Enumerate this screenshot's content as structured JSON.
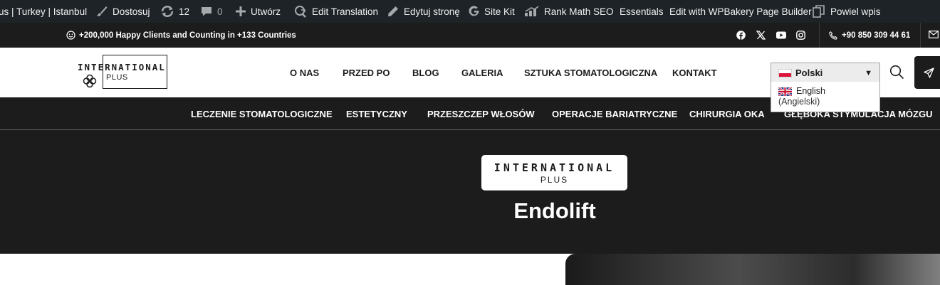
{
  "adminbar": {
    "site_name": "us | Turkey | Istanbul",
    "customize": "Dostosuj",
    "updates_count": "12",
    "comments_count": "0",
    "new": "Utwórz",
    "edit_translation": "Edit Translation",
    "edit_page": "Edytuj stronę",
    "site_kit": "Site Kit",
    "rank_math": "Rank Math SEO",
    "essentials": "Essentials",
    "wpbakery": "Edit with WPBakery Page Builder",
    "duplicate": "Powiel wpis"
  },
  "topbar": {
    "tagline": "+200,000 Happy Clients and Counting in +133 Countries",
    "phone": "+90 850 309 44 61",
    "social_icons": [
      "facebook-icon",
      "x-icon",
      "youtube-icon",
      "instagram-icon"
    ]
  },
  "header": {
    "logo": {
      "line1": "INTERNATIONAL",
      "line2": "PLUS"
    },
    "nav": [
      "O NAS",
      "PRZED PO",
      "BLOG",
      "GALERIA",
      "SZTUKA STOMATOLOGICZNA",
      "KONTAKT"
    ],
    "language": {
      "selected": "Polski",
      "option_name": "English",
      "option_native": "(Angielski)"
    }
  },
  "subnav": [
    "LECZENIE STOMATOLOGICZNE",
    "ESTETYCZNY",
    "PRZESZCZEP WŁOSÓW",
    "OPERACJE BARIATRYCZNE",
    "CHIRURGIA OKA",
    "GŁĘBOKA STYMULACJA MÓZGU"
  ],
  "hero": {
    "logo_line1": "INTERNATIONAL",
    "logo_line2": "PLUS",
    "title": "Endolift"
  },
  "colors": {
    "admin_bar": "#1d2327",
    "dark": "#1c1c1c",
    "white": "#ffffff"
  }
}
